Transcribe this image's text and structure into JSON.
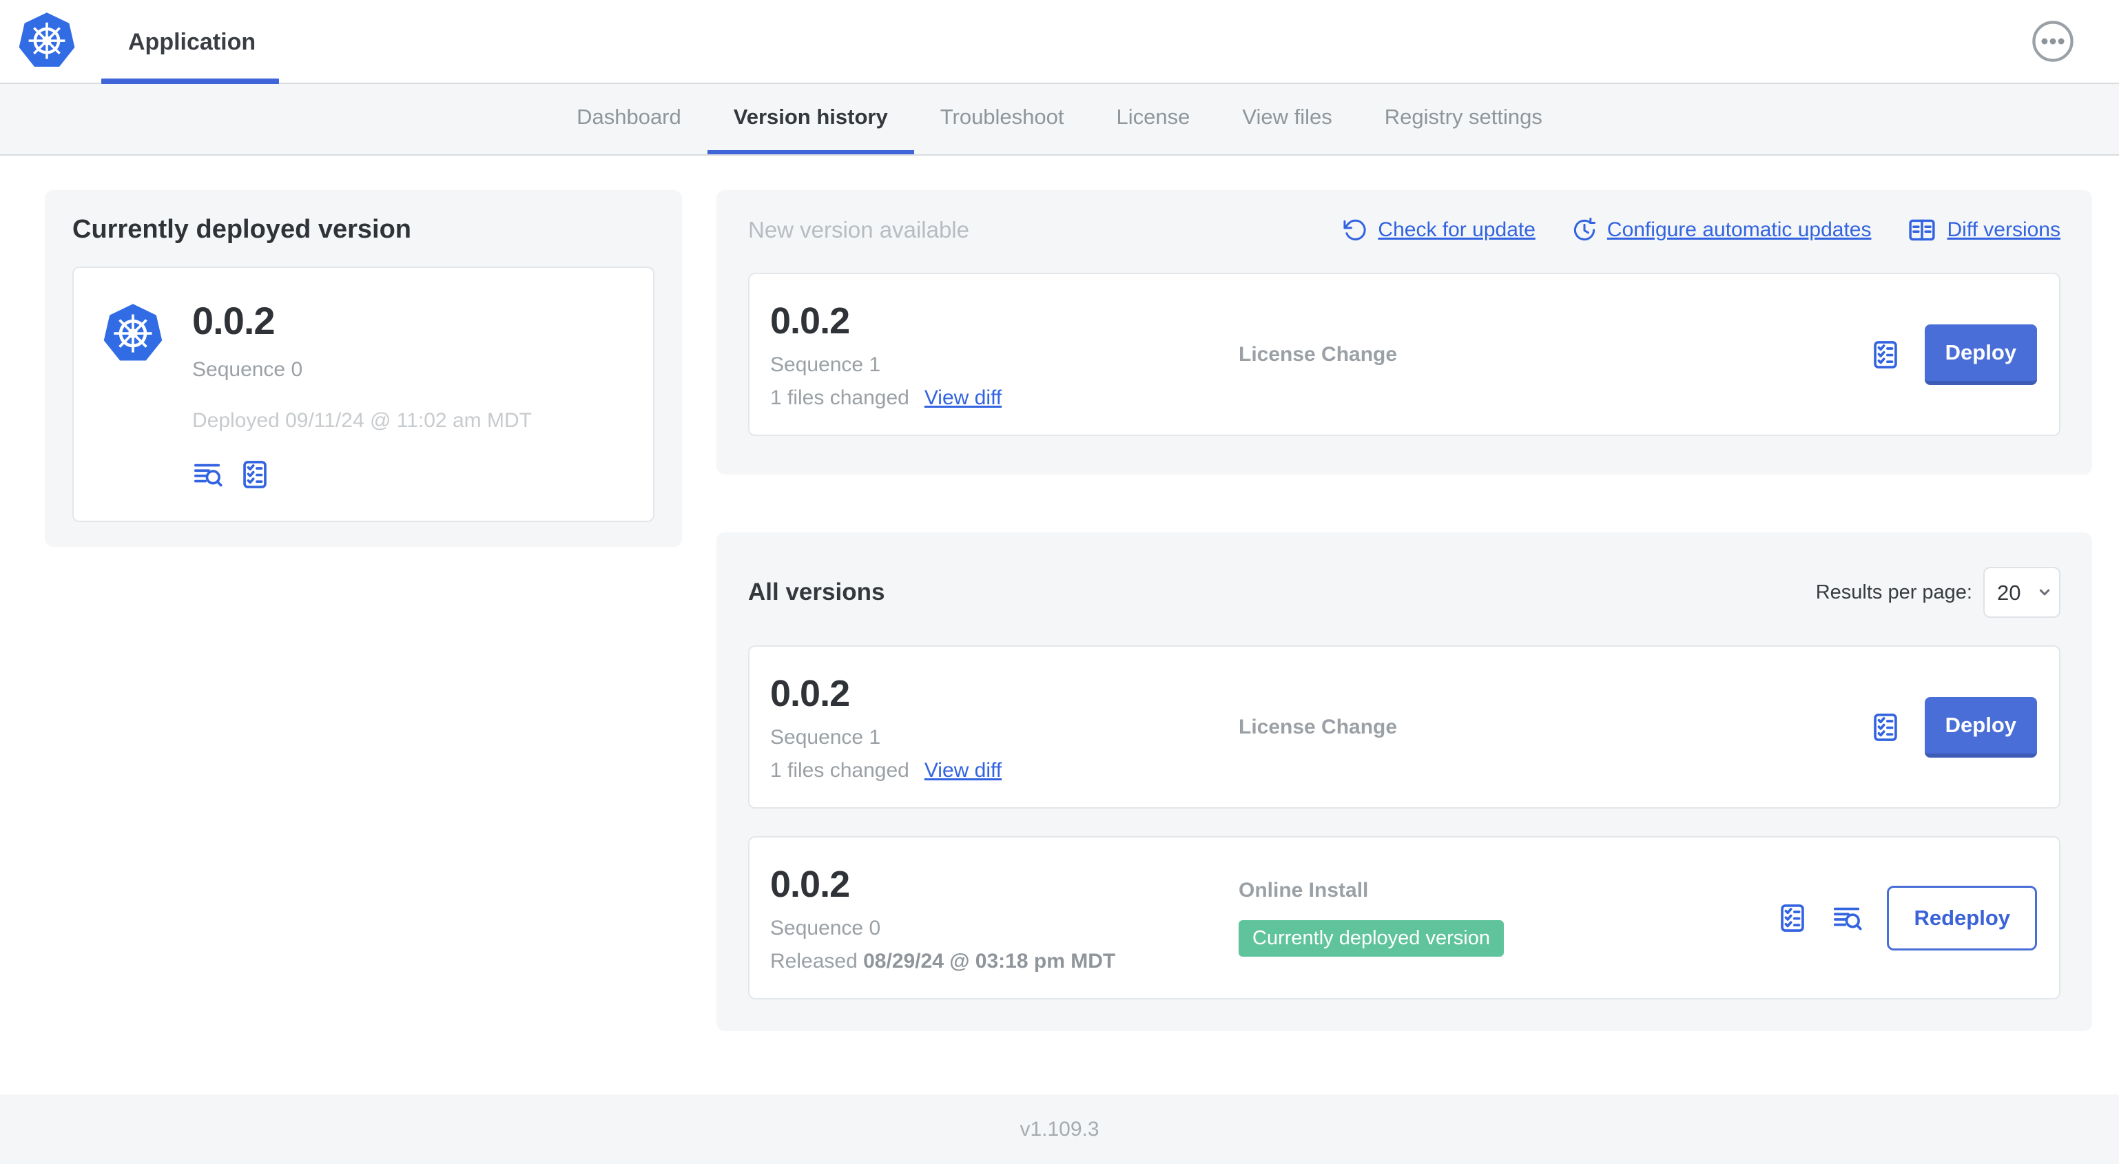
{
  "header": {
    "title": "Application"
  },
  "nav": {
    "tabs": [
      {
        "label": "Dashboard",
        "active": false
      },
      {
        "label": "Version history",
        "active": true
      },
      {
        "label": "Troubleshoot",
        "active": false
      },
      {
        "label": "License",
        "active": false
      },
      {
        "label": "View files",
        "active": false
      },
      {
        "label": "Registry settings",
        "active": false
      }
    ]
  },
  "current_version": {
    "title": "Currently deployed version",
    "version": "0.0.2",
    "sequence": "Sequence 0",
    "deployed": "Deployed 09/11/24 @ 11:02 am MDT"
  },
  "new_version": {
    "title": "New version available",
    "check_for_update": "Check for update",
    "configure_automatic_updates": "Configure automatic updates",
    "diff_versions": "Diff versions",
    "card": {
      "version": "0.0.2",
      "sequence": "Sequence 1",
      "files_changed": "1 files changed",
      "view_diff": "View diff",
      "source": "License Change",
      "deploy": "Deploy"
    }
  },
  "all_versions": {
    "title": "All versions",
    "results_per_page_label": "Results per page:",
    "results_per_page": "20",
    "rows": [
      {
        "version": "0.0.2",
        "sequence": "Sequence 1",
        "files_changed": "1 files changed",
        "view_diff": "View diff",
        "source": "License Change",
        "action": "Deploy"
      },
      {
        "version": "0.0.2",
        "sequence": "Sequence 0",
        "released_label": "Released",
        "released_date": "08/29/24 @ 03:18 pm MDT",
        "source": "Online Install",
        "badge": "Currently deployed version",
        "action": "Redeploy"
      }
    ]
  },
  "footer": {
    "version": "v1.109.3"
  },
  "colors": {
    "link_blue": "#3263e0",
    "button_blue": "#4a6ed7",
    "kubernetes_blue": "#326ce5",
    "badge_green": "#5fc49c",
    "panel_gray": "#f4f6f8"
  }
}
